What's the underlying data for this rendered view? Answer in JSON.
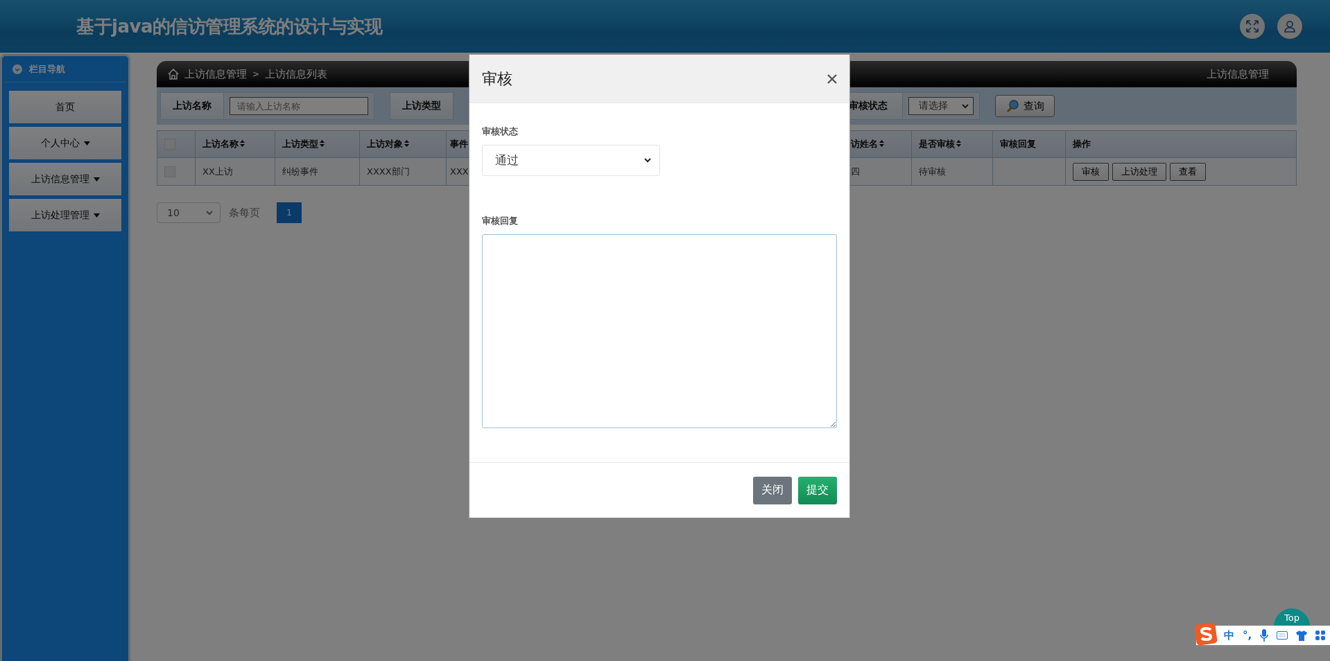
{
  "header": {
    "title": "基于java的信访管理系统的设计与实现"
  },
  "sidebar": {
    "title": "栏目导航",
    "items": [
      {
        "label": "首页",
        "has_menu": false
      },
      {
        "label": "个人中心",
        "has_menu": true
      },
      {
        "label": "上访信息管理",
        "has_menu": true
      },
      {
        "label": "上访处理管理",
        "has_menu": true
      }
    ]
  },
  "breadcrumb": {
    "items": [
      "上访信息管理",
      "上访信息列表"
    ],
    "separator": ">",
    "right_title": "上访信息管理"
  },
  "filters": [
    {
      "kind": "text",
      "label": "上访名称",
      "placeholder": "请输入上访名称"
    },
    {
      "kind": "hidden",
      "label": "上访类型"
    },
    {
      "kind": "select",
      "label": "审核状态",
      "value": "请选择"
    }
  ],
  "search_button": "查询",
  "table": {
    "select_all_checked": false,
    "columns": [
      {
        "label": "上访名称",
        "kind": "text",
        "sortable": true
      },
      {
        "label": "上访类型",
        "kind": "text",
        "sortable": true
      },
      {
        "label": "上访对象",
        "kind": "text",
        "sortable": true
      },
      {
        "label": "事件",
        "kind": "text",
        "sortable": false
      },
      {
        "label": "访姓名",
        "kind": "text",
        "sortable": true
      },
      {
        "label": "是否审核",
        "kind": "text",
        "sortable": true
      },
      {
        "label": "审核回复",
        "kind": "text",
        "sortable": false
      },
      {
        "label": "操作",
        "kind": "actions",
        "sortable": false
      }
    ],
    "rows": [
      {
        "checked": false,
        "cells": [
          "XX上访",
          "纠纷事件",
          "XXXX部门",
          "XXX",
          "四",
          "待审核"
        ],
        "actions": [
          "审核",
          "上访处理",
          "查看"
        ]
      }
    ]
  },
  "pagination": {
    "page_size": "10",
    "per_page_label": "条每页",
    "pages": [
      {
        "label": "1",
        "selected": true
      }
    ]
  },
  "modal": {
    "title": "审核",
    "fields": [
      {
        "kind": "select",
        "label": "审核状态",
        "value": "通过"
      },
      {
        "kind": "textarea",
        "label": "审核回复"
      }
    ],
    "buttons": [
      {
        "label": "关闭",
        "kind": "secondary"
      },
      {
        "label": "提交",
        "kind": "primary"
      }
    ]
  },
  "top_button": {
    "label": "Top"
  },
  "ime_toolbar": {
    "mode": "中",
    "punctuation": "°,"
  }
}
